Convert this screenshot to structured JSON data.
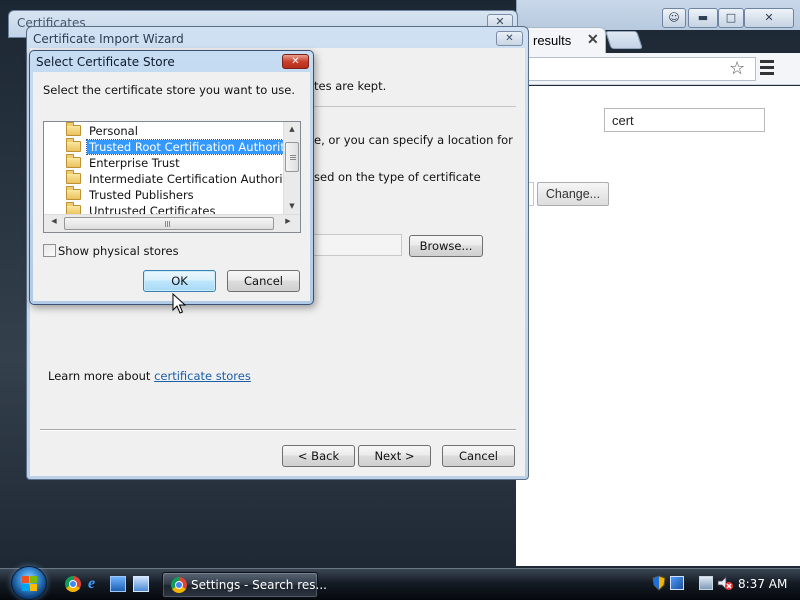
{
  "browser": {
    "tab_label": "results",
    "tab_close": "✕",
    "search_value": "cert",
    "change_button": "Change...",
    "window_controls": [
      "person-icon",
      "minimize-icon",
      "maximize-icon",
      "close-icon"
    ]
  },
  "certificates_window": {
    "title": "Certificates",
    "close": "✕",
    "left_fragment": "I"
  },
  "wizard": {
    "title": "Certificate Import Wizard",
    "close": "✕",
    "text_kept": "tes are kept.",
    "text_location": "e, or you can specify a location for",
    "text_based": "sed on the type of certificate",
    "browse_button": "Browse...",
    "learn_more_prefix": "Learn more about ",
    "learn_more_link": "certificate stores",
    "back_button": "< Back",
    "next_button": "Next >",
    "cancel_button": "Cancel"
  },
  "select_store": {
    "title": "Select Certificate Store",
    "close": "✕",
    "instruction": "Select the certificate store you want to use.",
    "stores": [
      {
        "label": "Personal",
        "selected": false
      },
      {
        "label": "Trusted Root Certification Authorities",
        "selected": true
      },
      {
        "label": "Enterprise Trust",
        "selected": false
      },
      {
        "label": "Intermediate Certification Authorities",
        "selected": false
      },
      {
        "label": "Trusted Publishers",
        "selected": false
      },
      {
        "label": "Untrusted Certificates",
        "selected": false
      }
    ],
    "show_physical": "Show physical stores",
    "show_physical_checked": false,
    "ok_button": "OK",
    "cancel_button": "Cancel"
  },
  "taskbar": {
    "quick_launch": [
      "chrome-icon",
      "ie-icon",
      "show-desktop-icon",
      "switch-windows-icon"
    ],
    "active_task": "Settings - Search res...",
    "tray_icons": [
      "shield-icon",
      "network-icon",
      "speaker-muted-icon"
    ],
    "clock": "8:37 AM"
  },
  "colors": {
    "selection": "#3399ff",
    "link": "#1a5ea8",
    "close_red": "#c9402a"
  }
}
